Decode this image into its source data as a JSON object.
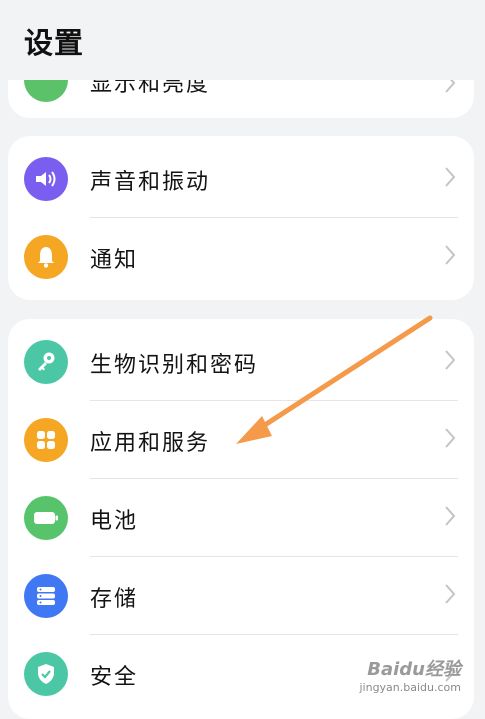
{
  "header": {
    "title": "设置"
  },
  "top_partial": {
    "label": "显示和亮度",
    "icon": "display-icon",
    "color": "#5cc26a"
  },
  "group_a": [
    {
      "label": "声音和振动",
      "icon": "speaker-icon",
      "color": "#7a5ef0"
    },
    {
      "label": "通知",
      "icon": "bell-icon",
      "color": "#f5a623"
    }
  ],
  "group_b": [
    {
      "label": "生物识别和密码",
      "icon": "key-icon",
      "color": "#4cc7a6"
    },
    {
      "label": "应用和服务",
      "icon": "apps-grid-icon",
      "color": "#f5a623"
    },
    {
      "label": "电池",
      "icon": "battery-icon",
      "color": "#57c46b"
    },
    {
      "label": "存储",
      "icon": "storage-icon",
      "color": "#3f78f2"
    },
    {
      "label": "安全",
      "icon": "shield-check-icon",
      "color": "#4cc7a6"
    }
  ],
  "watermark": {
    "brand": "Baidu经验",
    "url": "jingyan.baidu.com"
  },
  "annotation": {
    "color": "#f49a4a"
  }
}
